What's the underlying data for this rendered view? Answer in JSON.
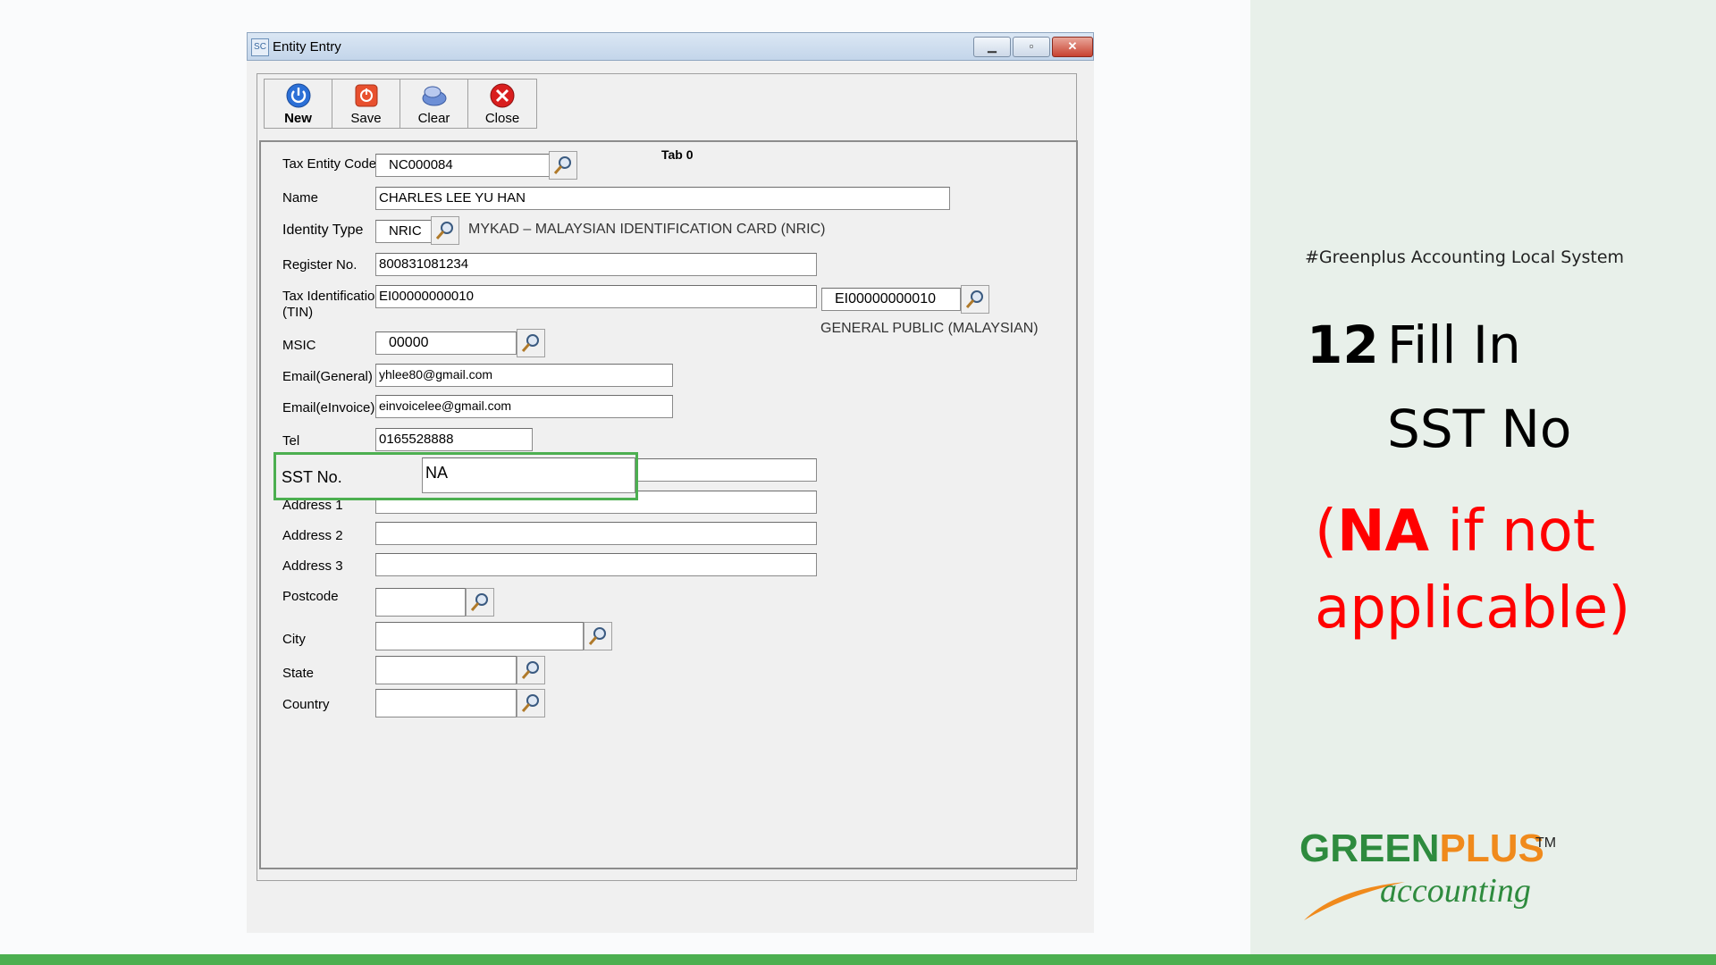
{
  "window": {
    "title": "Entity Entry",
    "icon_text": "SC"
  },
  "toolbar": {
    "new_label": "New",
    "save_label": "Save",
    "clear_label": "Clear",
    "close_label": "Close"
  },
  "form": {
    "tab_title": "Tab 0",
    "tax_entity_code": {
      "label": "Tax Entity Code",
      "value": "NC000084"
    },
    "name": {
      "label": "Name",
      "value": "CHARLES LEE YU HAN"
    },
    "identity_type": {
      "label": "Identity Type",
      "value": "NRIC",
      "description": "MYKAD – MALAYSIAN IDENTIFICATION CARD (NRIC)"
    },
    "register_no": {
      "label": "Register No.",
      "value": "800831081234"
    },
    "tin": {
      "label_line1": "Tax Identification",
      "label_line2": "(TIN)",
      "value": "EI00000000010",
      "lookup_value": "EI00000000010",
      "lookup_description": "GENERAL PUBLIC (MALAYSIAN)"
    },
    "msic": {
      "label": "MSIC",
      "value": "00000"
    },
    "email_general": {
      "label": "Email(General)",
      "value": "yhlee80@gmail.com"
    },
    "email_einvoice": {
      "label": "Email(eInvoice)",
      "value": "einvoicelee@gmail.com"
    },
    "tel": {
      "label": "Tel",
      "value": "0165528888"
    },
    "sst_no": {
      "label": "SST No.",
      "value": "NA"
    },
    "address1": {
      "label": "Address 1",
      "value": ""
    },
    "address2": {
      "label": "Address 2",
      "value": ""
    },
    "address3": {
      "label": "Address 3",
      "value": ""
    },
    "postcode": {
      "label": "Postcode",
      "value": ""
    },
    "city": {
      "label": "City",
      "value": ""
    },
    "state": {
      "label": "State",
      "value": ""
    },
    "country": {
      "label": "Country",
      "value": ""
    }
  },
  "side": {
    "hashtag": "#Greenplus Accounting Local System",
    "step_number": "12",
    "step_line1": "Fill In",
    "step_line2": "SST No",
    "note_open": "(",
    "note_bold": "NA",
    "note_rest": " if not applicable)",
    "logo_green": "GREEN",
    "logo_orange": "PLUS",
    "logo_tm": "TM",
    "logo_sub": "accounting"
  },
  "colors": {
    "accent_green": "#4caf50",
    "note_red": "#ff0000",
    "logo_green": "#2e8b3e",
    "logo_orange": "#f08a1c"
  }
}
